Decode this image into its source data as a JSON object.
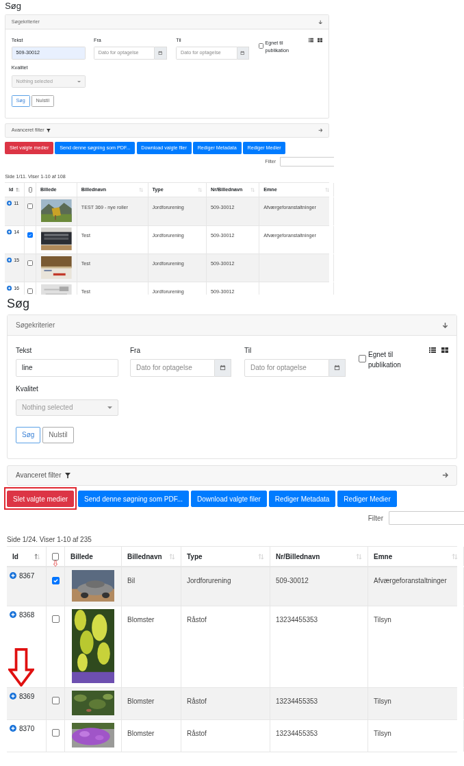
{
  "panels": [
    {
      "kind": "small",
      "title": "Søg",
      "search": {
        "header": "Søgekriterier",
        "text_label": "Tekst",
        "text_value": "509-30012",
        "autofilled": true,
        "from_label": "Fra",
        "from_placeholder": "Dato for optagelse",
        "to_label": "Til",
        "to_placeholder": "Dato for optagelse",
        "publish": {
          "label": "Egnet til publikation",
          "checked": false
        },
        "quality_label": "Kvalitet",
        "quality_placeholder": "Nothing selected",
        "buttons": [
          {
            "label": "Søg",
            "kind": "primary"
          },
          {
            "label": "Nulstil",
            "kind": "default"
          }
        ]
      },
      "advanced_filter": "Avanceret filter",
      "actions": [
        {
          "label": "Slet valgte medier",
          "kind": "danger"
        },
        {
          "label": "Send denne søgning som PDF...",
          "kind": "primary"
        },
        {
          "label": "Download valgte filer",
          "kind": "primary"
        },
        {
          "label": "Rediger Metadata",
          "kind": "primary"
        },
        {
          "label": "Rediger Medier",
          "kind": "primary"
        }
      ],
      "filter_label": "Filter",
      "page_info": "Side 1/11. Viser 1-10 af 108",
      "columns": [
        {
          "kind": "sortable",
          "label": "Id",
          "sorted": true
        },
        {
          "kind": "checkbox",
          "checked": false
        },
        {
          "kind": "plain",
          "label": "Billede"
        },
        {
          "kind": "sortable",
          "label": "Billednavn",
          "sorted": false
        },
        {
          "kind": "sortable",
          "label": "Type",
          "sorted": false
        },
        {
          "kind": "sortable",
          "label": "Nr/Billednavn",
          "sorted": false
        },
        {
          "kind": "sortable",
          "label": "Emne",
          "sorted": false
        }
      ],
      "rows": [
        {
          "id": "11",
          "selected": false,
          "name": "TEST 369 - nye roller",
          "type": "Jordforurening",
          "nr": "509-30012",
          "emne": "Afværgeforanstaltninger"
        },
        {
          "id": "14",
          "selected": true,
          "name": "Test",
          "type": "Jordforurening",
          "nr": "509-30012",
          "emne": "Afværgeforanstaltninger"
        },
        {
          "id": "15",
          "selected": false,
          "name": "Test",
          "type": "Jordforurening",
          "nr": "509-30012"
        },
        {
          "id": "16",
          "selected": false,
          "name": "Test",
          "type": "Jordforurening",
          "nr": "509-30012"
        }
      ]
    },
    {
      "kind": "large",
      "title": "Søg",
      "search": {
        "header": "Søgekriterier",
        "text_label": "Tekst",
        "text_value": "line",
        "autofilled": false,
        "from_label": "Fra",
        "from_placeholder": "Dato for optagelse",
        "to_label": "Til",
        "to_placeholder": "Dato for optagelse",
        "publish": {
          "label": "Egnet til publikation",
          "checked": false
        },
        "quality_label": "Kvalitet",
        "quality_placeholder": "Nothing selected",
        "buttons": [
          {
            "label": "Søg",
            "kind": "primary"
          },
          {
            "label": "Nulstil",
            "kind": "default"
          }
        ]
      },
      "advanced_filter": "Avanceret filter",
      "actions": [
        {
          "label": "Slet valgte medier",
          "kind": "danger",
          "highlighted": true
        },
        {
          "label": "Send denne søgning som PDF...",
          "kind": "primary"
        },
        {
          "label": "Download valgte filer",
          "kind": "primary"
        },
        {
          "label": "Rediger Metadata",
          "kind": "primary"
        },
        {
          "label": "Rediger Medier",
          "kind": "primary"
        }
      ],
      "filter_label": "Filter",
      "page_info": "Side 1/24. Viser 1-10 af 235",
      "columns": [
        {
          "kind": "sortable",
          "label": "Id",
          "sorted": true
        },
        {
          "kind": "checkbox",
          "checked": false
        },
        {
          "kind": "plain",
          "label": "Billede"
        },
        {
          "kind": "sortable",
          "label": "Billednavn",
          "sorted": false
        },
        {
          "kind": "sortable",
          "label": "Type",
          "sorted": false
        },
        {
          "kind": "sortable",
          "label": "Nr/Billednavn",
          "sorted": false
        },
        {
          "kind": "sortable",
          "label": "Emne",
          "sorted": false
        }
      ],
      "rows": [
        {
          "id": "8367",
          "selected": true,
          "annotation": {
            "kind": "checkbox-arrow"
          },
          "name": "Bil",
          "type": "Jordforurening",
          "nr": "509-30012",
          "emne": "Afværgeforanstaltninger"
        },
        {
          "id": "8368",
          "selected": false,
          "name": "Blomster",
          "type": "Råstof",
          "nr": "13234455353",
          "emne": "Tilsyn"
        },
        {
          "id": "8369",
          "selected": false,
          "annotation": {
            "kind": "id-arrow"
          },
          "name": "Blomster",
          "type": "Råstof",
          "nr": "13234455353",
          "emne": "Tilsyn"
        },
        {
          "id": "8370",
          "selected": false,
          "name": "Blomster",
          "type": "Råstof",
          "nr": "13234455353",
          "emne": "Tilsyn"
        }
      ]
    }
  ]
}
